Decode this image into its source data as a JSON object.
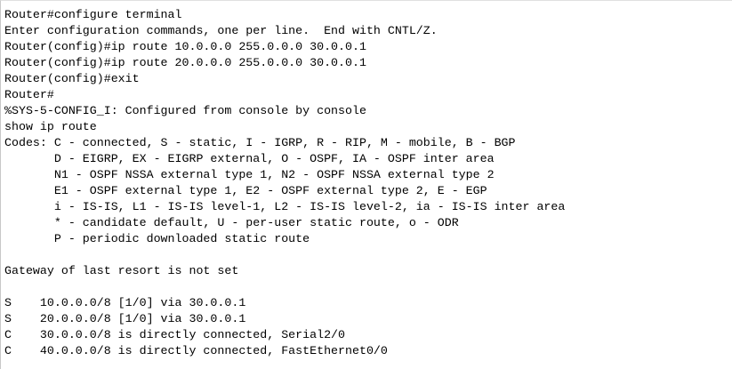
{
  "console": {
    "lines": [
      "Router#configure terminal",
      "Enter configuration commands, one per line.  End with CNTL/Z.",
      "Router(config)#ip route 10.0.0.0 255.0.0.0 30.0.0.1",
      "Router(config)#ip route 20.0.0.0 255.0.0.0 30.0.0.1",
      "Router(config)#exit",
      "Router#",
      "%SYS-5-CONFIG_I: Configured from console by console",
      "show ip route",
      "Codes: C - connected, S - static, I - IGRP, R - RIP, M - mobile, B - BGP",
      "       D - EIGRP, EX - EIGRP external, O - OSPF, IA - OSPF inter area",
      "       N1 - OSPF NSSA external type 1, N2 - OSPF NSSA external type 2",
      "       E1 - OSPF external type 1, E2 - OSPF external type 2, E - EGP",
      "       i - IS-IS, L1 - IS-IS level-1, L2 - IS-IS level-2, ia - IS-IS inter area",
      "       * - candidate default, U - per-user static route, o - ODR",
      "       P - periodic downloaded static route",
      "",
      "Gateway of last resort is not set",
      "",
      "S    10.0.0.0/8 [1/0] via 30.0.0.1",
      "S    20.0.0.0/8 [1/0] via 30.0.0.1",
      "C    30.0.0.0/8 is directly connected, Serial2/0",
      "C    40.0.0.0/8 is directly connected, FastEthernet0/0"
    ]
  }
}
